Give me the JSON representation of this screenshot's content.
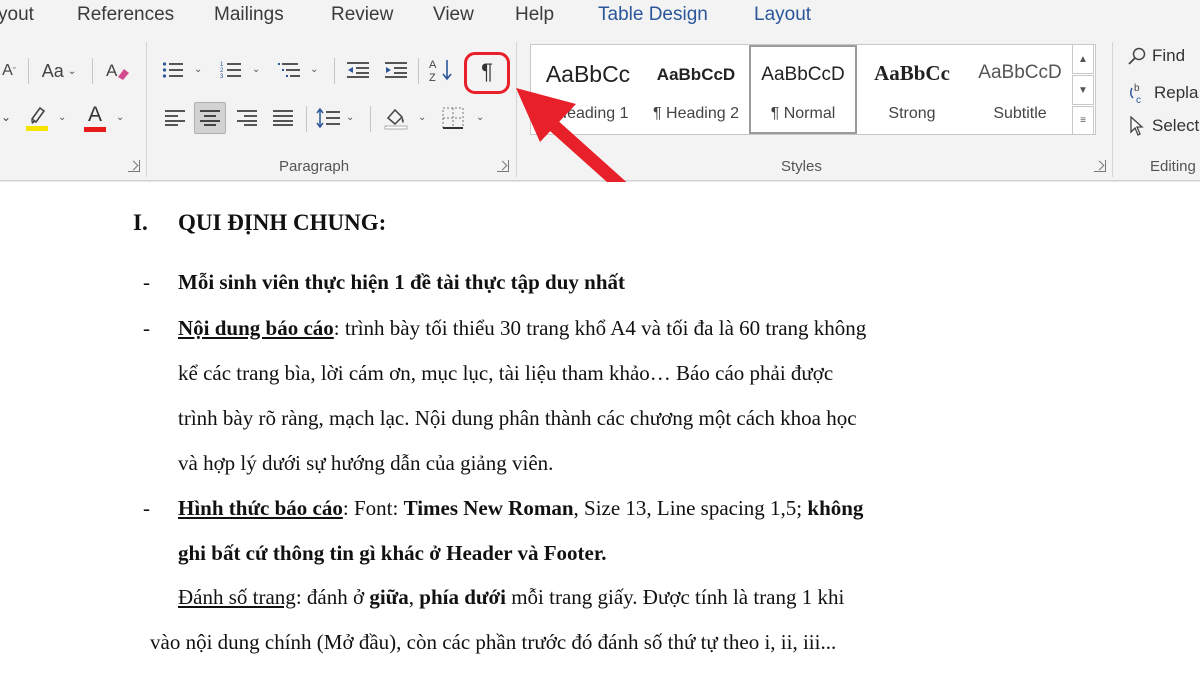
{
  "ribbon": {
    "tabs": [
      "yout",
      "References",
      "Mailings",
      "Review",
      "View",
      "Help",
      "Table Design",
      "Layout"
    ],
    "font_group": {
      "change_case_label": "Aa",
      "font_color_label": "A"
    },
    "paragraph": {
      "group_label": "Paragraph",
      "sort_label": "A↓Z",
      "pilcrow_label": "¶"
    },
    "styles": {
      "group_label": "Styles",
      "items": [
        {
          "preview": "AaBbCc",
          "name": "Heading 1"
        },
        {
          "preview": "AaBbCcD",
          "name": "¶ Heading 2"
        },
        {
          "preview": "AaBbCcD",
          "name": "¶ Normal"
        },
        {
          "preview": "AaBbCc",
          "name": "Strong"
        },
        {
          "preview": "AaBbCcD",
          "name": "Subtitle"
        }
      ]
    },
    "editing": {
      "group_label": "Editing",
      "find": "Find",
      "replace": "Repla",
      "select": "Select"
    },
    "colors": {
      "highlight": "#f4e400",
      "font_color": "#e81a1a",
      "annotation": "#e8202a",
      "contextual_tab": "#2b579a"
    }
  },
  "document": {
    "heading": {
      "number": "I.",
      "text": "QUI  ĐỊNH CHUNG:"
    },
    "bullet_char": "-",
    "b1": "Mỗi sinh viên thực hiện 1 đề tài thực tập duy nhất",
    "b2": {
      "label": "Nội dung báo cáo",
      "line1": ": trình bày tối thiểu 30 trang khổ A4 và tối đa là 60 trang không",
      "line2": "kể các trang bìa, lời cám ơn, mục lục, tài liệu tham khảo… Báo cáo phải được",
      "line3": "trình bày rõ ràng, mạch lạc. Nội dung phân thành các chương một cách khoa học",
      "line4": "và hợp lý dưới sự hướng dẫn của giảng viên."
    },
    "b3": {
      "label": "Hình thức báo cáo",
      "p1": ": Font: ",
      "font": "Times New Roman",
      "p2": ", Size 13, Line spacing 1,5; ",
      "p3": "không",
      "line2": "ghi bất cứ thông tin gì khác ở Header và Footer."
    },
    "p4": {
      "label": "Đánh số trang",
      "p1": ": đánh ở ",
      "giua": "giữa",
      "comma": ", ",
      "phiaduoi": "phía dưới",
      "p2": " mỗi trang giấy. Được tính là trang 1 khi",
      "line2": "vào nội dung chính (Mở đầu), còn các phần trước đó đánh số thứ tự theo i, ii, iii..."
    }
  }
}
